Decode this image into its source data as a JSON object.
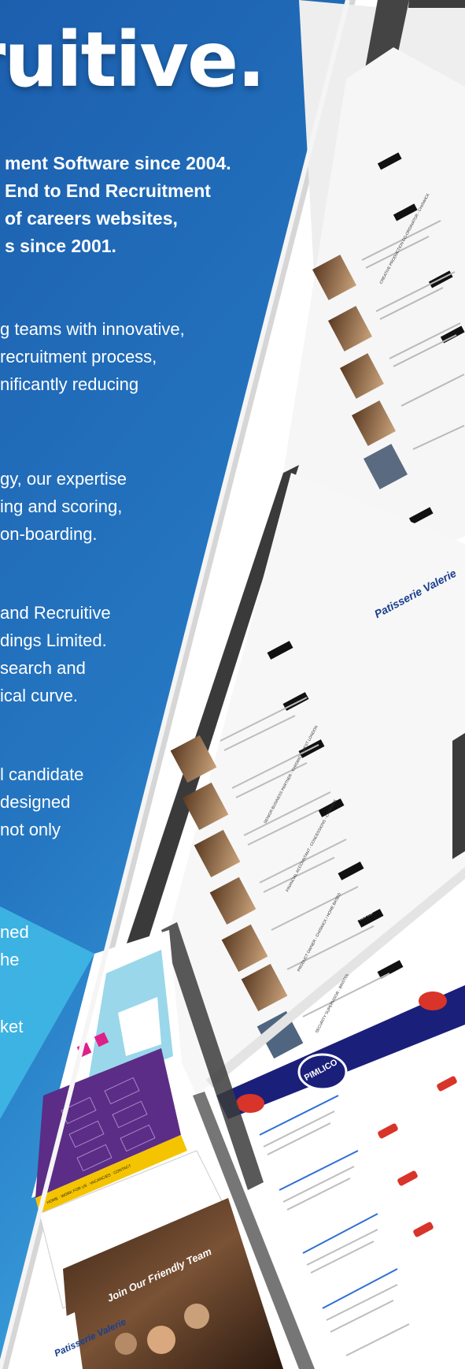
{
  "headline": "ruitive.",
  "intro_bold": [
    "ment Software since 2004.",
    "End to End Recruitment",
    "of careers websites,",
    "s since 2001."
  ],
  "para1": [
    "g teams with innovative,",
    " recruitment process,",
    "nificantly reducing"
  ],
  "para2": [
    "gy, our expertise",
    "ing and scoring,",
    "on-boarding."
  ],
  "para3": [
    "and Recruitive",
    "dings Limited.",
    "search and",
    "ical curve."
  ],
  "para4": [
    "l candidate",
    "designed",
    "not only"
  ],
  "para5": [
    "ned",
    "he"
  ],
  "para6": [
    "ket"
  ],
  "screens": {
    "brand_patisserie": "Patisserie Valerie",
    "brand_pimlico": "PIMLICO",
    "banner_join": "Join Our Friendly Team",
    "nav_items": "HOME · WORK FOR US · VACANCIES · CONTACT",
    "job_titles": [
      "CREATIVE PRODUCTION CO-ORDINATOR - CHISWICK",
      "SENIOR BUSINESS PARTNER - CHISWICK, WEST LONDON",
      "FINANCIAL ACCOUNTANT - CONCESSIONS - CHISWICK",
      "PRODUCT OWNER - CHISWICK / HOME BASED",
      "SECURITY SUPERVISOR - BRISTOL"
    ],
    "view_label": "VIEW JOB"
  },
  "colors": {
    "blue_top": "#1f63b3",
    "blue_mid": "#2b83cc",
    "shadow_dark": "#3f3f3f",
    "screen_bg": "#f3f3f3",
    "pimlico_navy": "#1a1f7a",
    "purple": "#5b2d86",
    "cyan": "#8fd3e8"
  }
}
